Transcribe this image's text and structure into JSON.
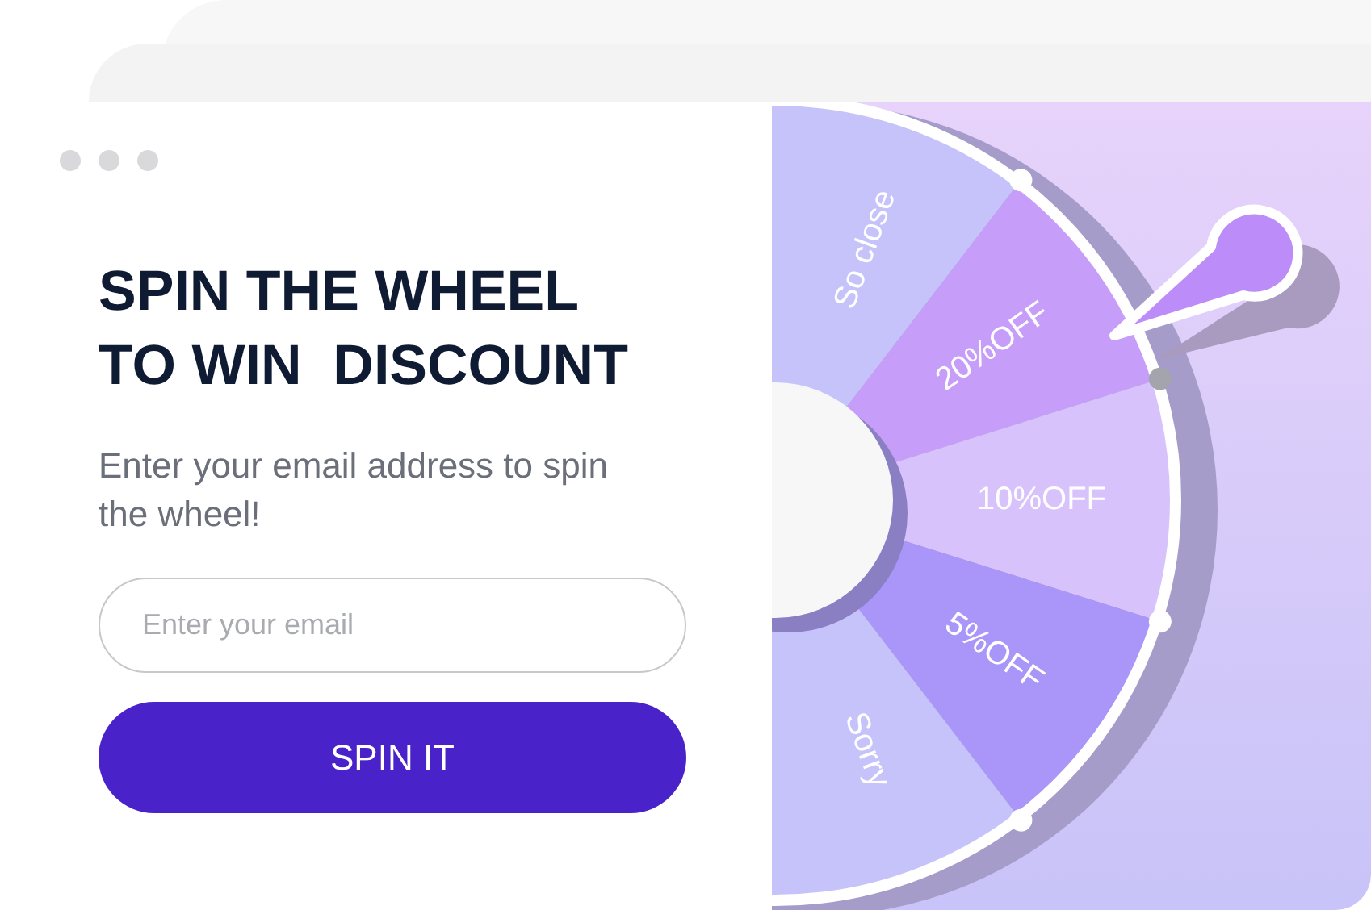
{
  "title_lines": [
    "SPIN THE WHEEL",
    "TO WIN  DISCOUNT"
  ],
  "subtitle": "Enter your email address to spin the wheel!",
  "email": {
    "placeholder": "Enter your email"
  },
  "button": "SPIN IT",
  "wheel": {
    "segments": [
      {
        "label": "So close",
        "color": "#c6c3fa"
      },
      {
        "label": "20%OFF",
        "color": "#c79dfa"
      },
      {
        "label": "10%OFF",
        "color": "#d8c2fb"
      },
      {
        "label": "5%OFF",
        "color": "#a996f8"
      },
      {
        "label": "Sorry",
        "color": "#c6c3fa"
      }
    ]
  }
}
